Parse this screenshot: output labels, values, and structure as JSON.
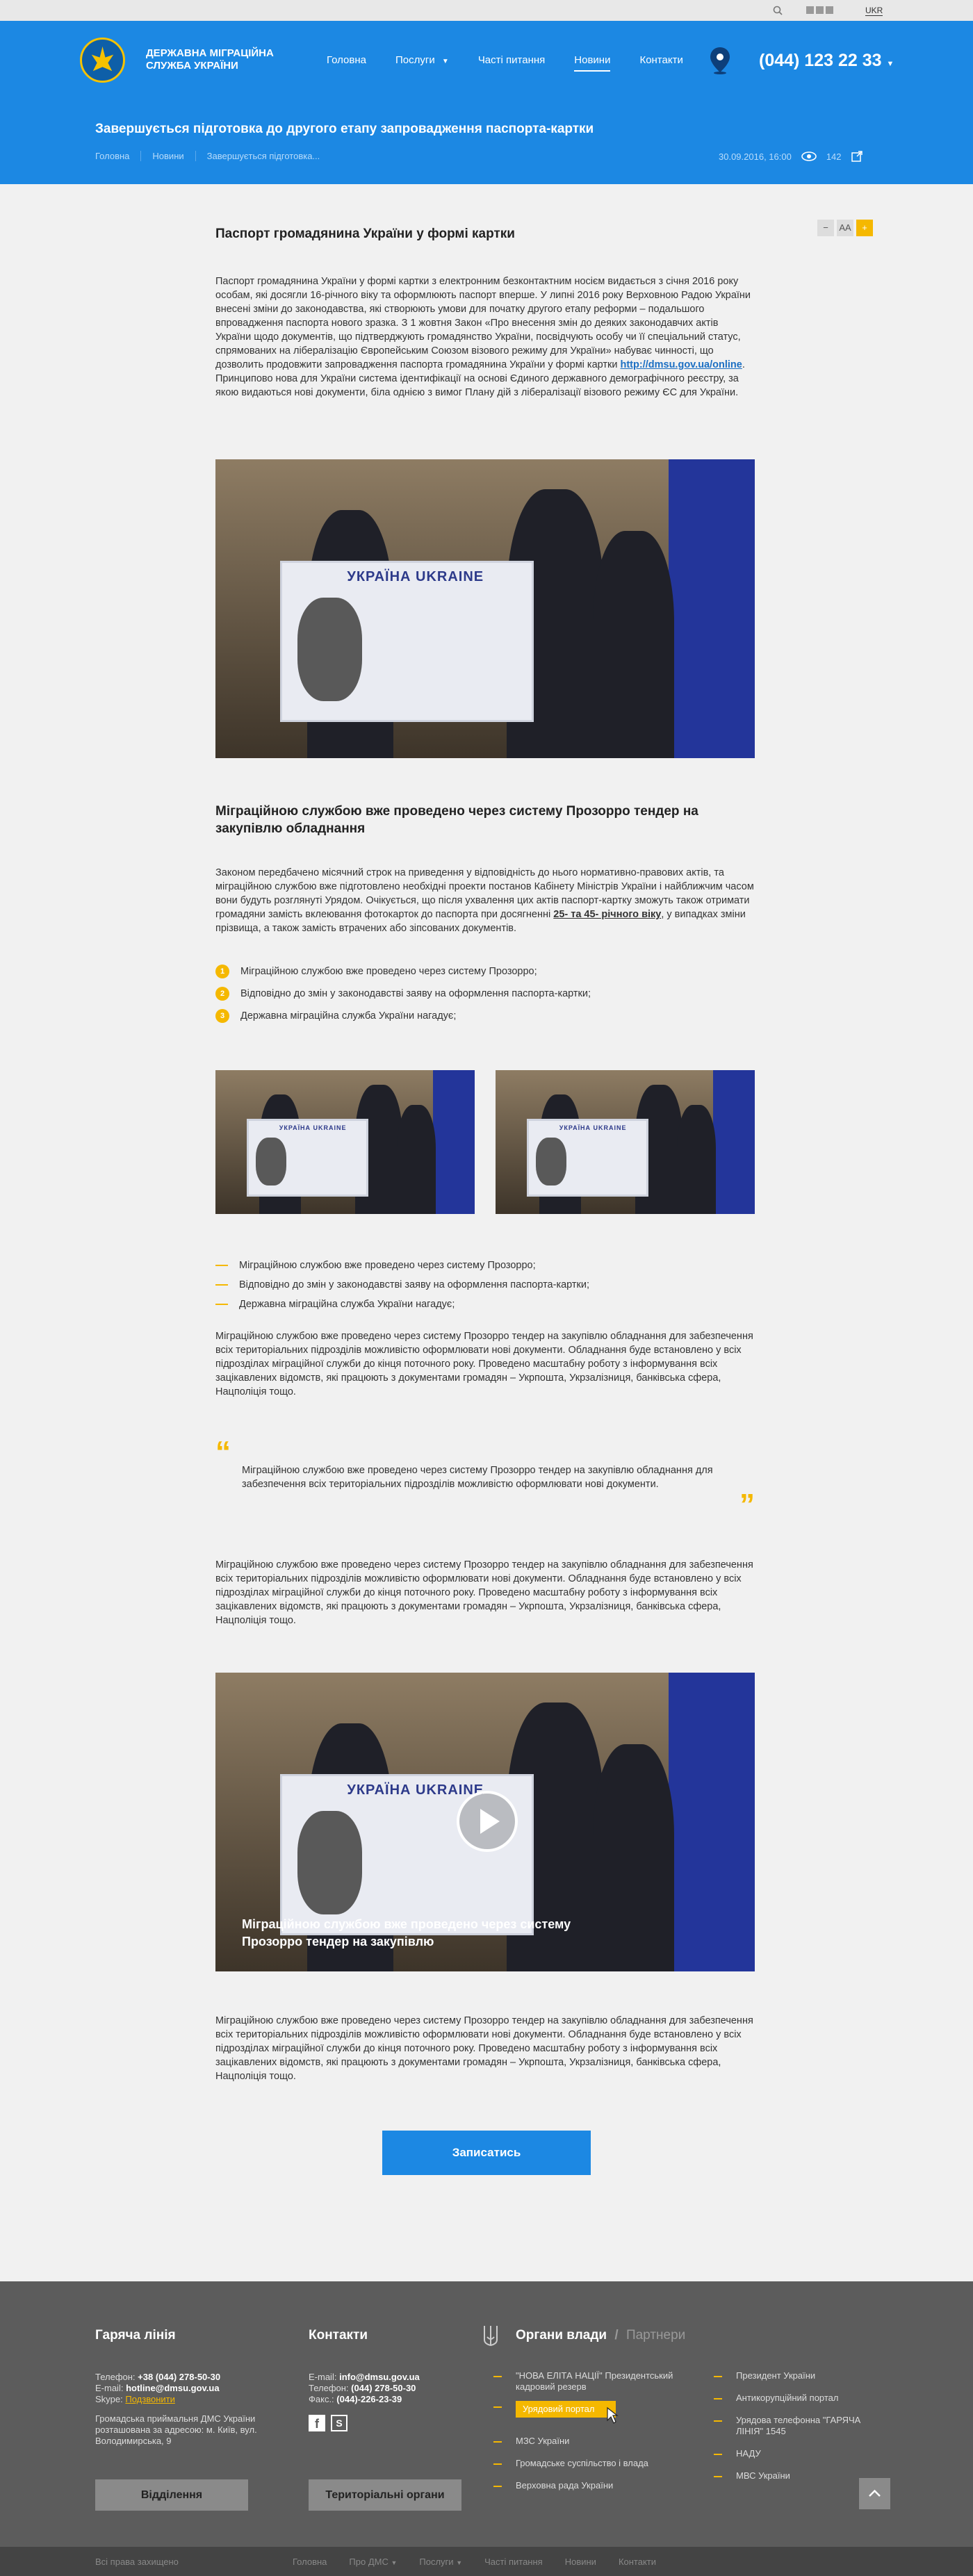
{
  "utility": {
    "lang": "UKR"
  },
  "header": {
    "brand": "ДЕРЖАВНА МІГРАЦІЙНА СЛУЖБА УКРАЇНИ",
    "nav": [
      "Головна",
      "Послуги",
      "Часті питання",
      "Новини",
      "Контакти"
    ],
    "phone": "(044) 123 22 33"
  },
  "title_bar": {
    "title": "Завершується підготовка до другого етапу запровадження паспорта-картки",
    "breadcrumbs": [
      "Головна",
      "Новини",
      "Завершується підготовка..."
    ],
    "date": "30.09.2016, 16:00",
    "views": "142"
  },
  "article": {
    "h1": "Паспорт громадянина України у формі картки",
    "p1a": "Паспорт громадянина України у формі картки з електронним безконтактним носієм видається з січня 2016 року особам, які досягли 16-річного віку та оформлюють паспорт вперше. У липні 2016 року Верховною Радою України внесені зміни до законодавства, які створюють умови для початку другого етапу реформи – подальшого впровадження паспорта нового зразка. З 1 жовтня Закон «Про внесення змін до деяких законодавчих актів України щодо документів, що підтверджують громадянство України, посвідчують особу чи її спеціальний статус, спрямованих на лібералізацію Європейським Союзом візового режиму для України» набуває чинності, що дозволить продовжити запровадження паспорта громадянина України у формі картки ",
    "p1link": "http://dmsu.gov.ua/online",
    "p1b": ". Принципово нова для України система ідентифікації на основі Єдиного державного демографічного реєстру, за якою видаються нові документи, біла однією з вимог Плану дій з лібералізації візового режиму ЄС для України.",
    "card_top": "УКРАЇНА UKRAINE",
    "h2": "Міграційною службою вже проведено через систему Прозорро тендер на закупівлю обладнання",
    "p2a": "Законом передбачено місячний строк на приведення у відповідність до нього нормативно-правових актів, та міграційною службою вже підготовлено необхідні проекти постанов Кабінету Міністрів України і найближчим часом вони будуть розглянуті Урядом. Очікується, що після ухвалення цих актів паспорт-картку зможуть також отримати громадяни замість вклеювання фотокарток до паспорта при досягненні ",
    "p2em": "25- та 45- річного віку",
    "p2b": ", у випадках зміни прізвища, а також замість втрачених або зіпсованих документів.",
    "list": [
      "Міграційною службою вже проведено через систему Прозорро;",
      "Відповідно до змін у законодавстві заяву на оформлення паспорта-картки;",
      "Державна міграційна служба України нагадує;"
    ],
    "p3": "Міграційною службою вже проведено через систему Прозорро тендер на закупівлю обладнання для забезпечення всіх територіальних підрозділів можливістю оформлювати нові документи. Обладнання буде встановлено у всіх підрозділах міграційної служби до кінця поточного року. Проведено масштабну роботу з інформування всіх зацікавлених відомств, які працюють з документами громадян – Укрпошта, Укрзалізниця, банківська сфера, Нацполіція тощо.",
    "quote": "Міграційною службою вже проведено через систему Прозорро тендер на закупівлю обладнання для забезпечення всіх територіальних підрозділів можливістю оформлювати нові документи.",
    "video_caption": "Міграційною службою вже проведено через систему Прозорро тендер на закупівлю",
    "cta": "Записатись"
  },
  "footer": {
    "hotline_title": "Гаряча лінія",
    "hotline_phone_label": "Телефон:",
    "hotline_phone": "+38 (044) 278-50-30",
    "hotline_email_label": "E-mail:",
    "hotline_email": "hotline@dmsu.gov.ua",
    "hotline_skype_label": "Skype:",
    "hotline_skype": "Подзвонити",
    "hotline_address": "Громадська приймальня ДМС України розташована за адресою: м. Київ, вул. Володимирська, 9",
    "contacts_title": "Контакти",
    "contacts_email_label": "E-mail:",
    "contacts_email": "info@dmsu.gov.ua",
    "contacts_phone_label": "Телефон:",
    "contacts_phone": "(044) 278-50-30",
    "contacts_fax_label": "Факс.:",
    "contacts_fax": "(044)-226-23-39",
    "btn_dept": "Відділення",
    "btn_terr": "Територіальні органи",
    "organs_title": "Органи влади",
    "organs_slash": "/",
    "partners_title": "Партнери",
    "col1": [
      "\"НОВА ЕЛІТА НАЦІЇ\" Президентський кадровий резерв",
      "Урядовий портал",
      "МЗС України",
      "Громадське суспільство і влада",
      "Верховна рада України"
    ],
    "col2": [
      "Президент України",
      "Антикорупційний портал",
      "Урядова телефонна \"ГАРЯЧА ЛІНІЯ\" 1545",
      "НАДУ",
      "МВС України"
    ],
    "copyright": "Всі права захищено",
    "bottom_nav": [
      "Головна",
      "Про ДМС",
      "Послуги",
      "Часті питання",
      "Новини",
      "Контакти"
    ]
  }
}
